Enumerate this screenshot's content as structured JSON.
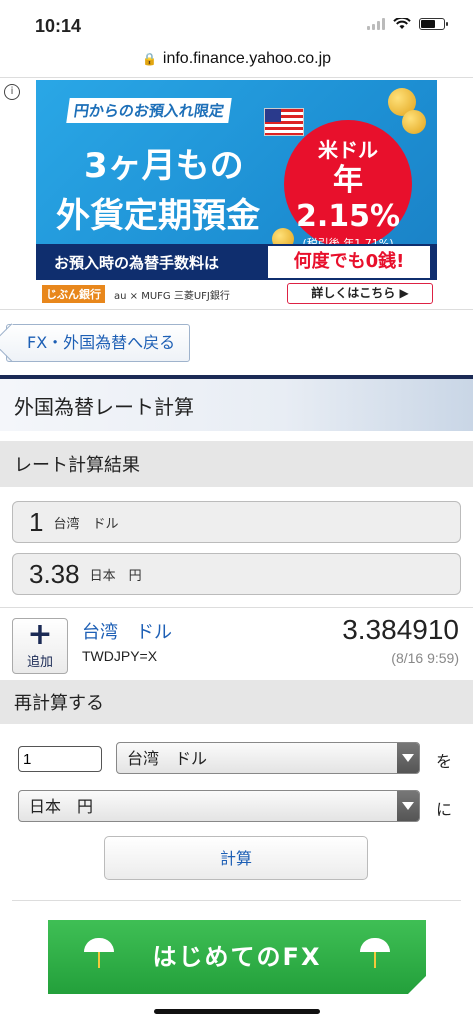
{
  "status_bar": {
    "time": "10:14"
  },
  "browser": {
    "url": "info.finance.yahoo.co.jp"
  },
  "ad": {
    "info_icon": "i",
    "top_label": "円からのお預入れ限定",
    "headline_1": "3ヶ月もの",
    "headline_2": "外貨定期預金",
    "rate_currency": "米ドル",
    "rate_value": "年2.15%",
    "rate_note": "(税引後 年1.71%)",
    "strip_left": "お預入時の為替手数料は",
    "strip_right": "何度でも0銭!",
    "bank_logo": "じぶん銀行",
    "partner_logos": "au × MUFG 三菱UFJ銀行",
    "details_button": "詳しくはこちら ▶"
  },
  "back_link": {
    "label": "FX・外国為替へ戻る"
  },
  "page": {
    "title": "外国為替レート計算"
  },
  "result": {
    "header": "レート計算結果",
    "from_amount": "1",
    "from_unit": "台湾　ドル",
    "to_amount": "3.38",
    "to_unit": "日本　円"
  },
  "quote": {
    "add_label": "追加",
    "name": "台湾　ドル",
    "code": "TWDJPY=X",
    "price": "3.384910",
    "timestamp": "(8/16 9:59)"
  },
  "recalc": {
    "header": "再計算する",
    "amount_value": "1",
    "from_select": "台湾　ドル",
    "from_particle": "を",
    "to_select": "日本　円",
    "to_particle": "に",
    "calc_button": "計算"
  },
  "fx_banner": {
    "label": "はじめてのFX"
  }
}
